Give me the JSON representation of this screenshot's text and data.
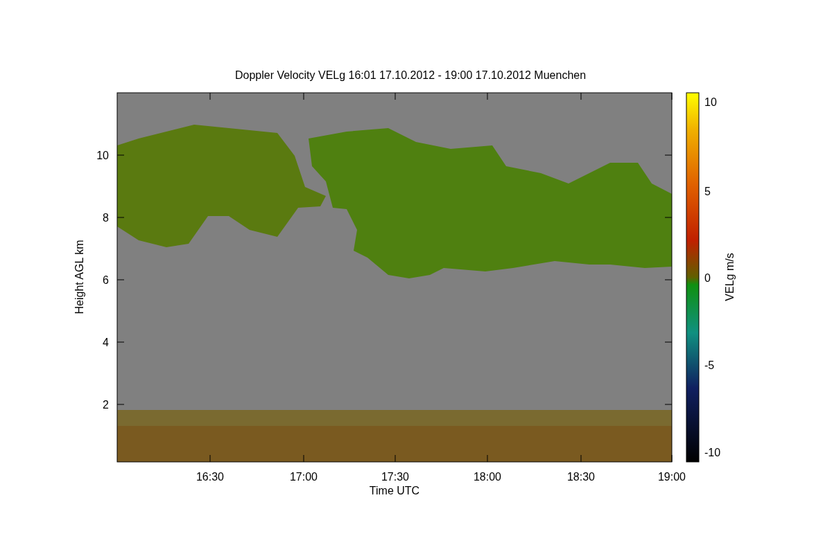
{
  "chart": {
    "title": "Doppler Velocity VELg   16:01 17.10.2012 - 19:00 17.10.2012 Muenchen",
    "ylabel": "Height AGL km",
    "xlabel": "Time UTC",
    "yticks": [
      "10",
      "8",
      "6",
      "4",
      "2"
    ],
    "xticks": [
      "16:30",
      "17:00",
      "17:30",
      "18:00",
      "18:30",
      "19:00"
    ],
    "colorbar": {
      "label": "VELg m/s",
      "ticks": [
        "10",
        "5",
        "0",
        "-5",
        "-10"
      ]
    }
  }
}
